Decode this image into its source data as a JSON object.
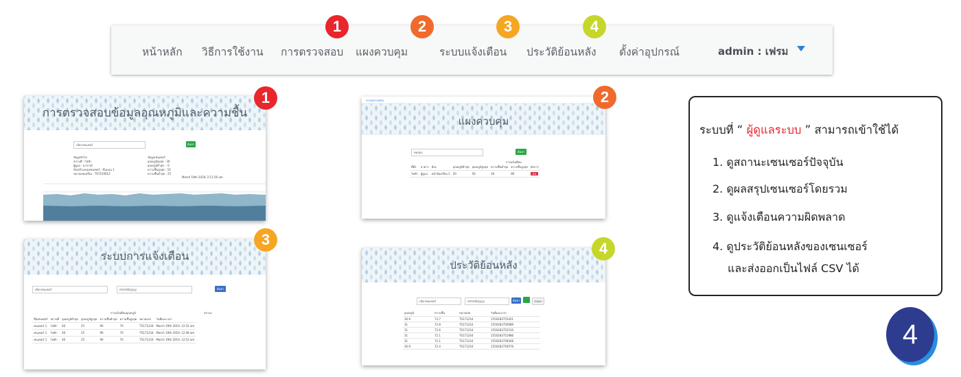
{
  "nav": {
    "items": [
      "หน้าหลัก",
      "วิธีการใช้งาน",
      "การตรวจสอบ",
      "แผงควบคุม",
      "ระบบแจ้งเตือน",
      "ประวัติย้อนหลัง",
      "ตั้งค่าอุปกรณ์"
    ],
    "user": "admin : เฟรม"
  },
  "badges": {
    "b1": "1",
    "b2": "2",
    "b3": "3",
    "b4": "4",
    "colors": {
      "b1": "#e8262c",
      "b2": "#ef6a2c",
      "b3": "#f5a623",
      "b4": "#c6d62b"
    }
  },
  "shot1": {
    "title": "การตรวจสอบข้อมูลอุณหภูมิและความชื้น",
    "select": "เลือกเซนเซอร์",
    "button": "ค้นหา",
    "info_left": [
      "ข้อมูลทั่วไป",
      "สถานที่ : ไฟฟ้า",
      "ผู้ดูแล : อาจารย์",
      "ห้อง/ตำแหน่งเซนเซอร์ : ชั้นบนน 1",
      "หมายเลขเครื่อง : TS7150012"
    ],
    "info_right": [
      "ข้อมูลเซนเซอร์",
      "อุณหภูมิสูงสุด : 30",
      "อุณหภูมิต่ำสุด : -5",
      "ความชื้นสูงสุด : 10",
      "ความชื้นต่ำสุด : 25"
    ],
    "timestamp": "March 19th 2019, 2:11:56 am"
  },
  "shot2": {
    "brand": "ระบบตรวจสอบ",
    "title": "แผงควบคุม",
    "select": "ทดสอบ",
    "button": "ค้นหา",
    "group_header": "การแจ้งเตือน",
    "headers": [
      "ที่ตั้ง",
      "อาคาร",
      "ห้อง",
      "อุณหภูมิต่ำสุด",
      "อุณหภูมิสูงสุด",
      "ความชื้นต่ำสุด",
      "ความชื้นสูงสุด",
      "จัดการ"
    ],
    "row": [
      "ไฟฟ้า",
      "ผู้ดูแล",
      "หน้าห้องเรียน 2",
      "20",
      "50",
      "30",
      "80"
    ],
    "action": "ลบ"
  },
  "shot3": {
    "title": "ระบบการแจ้งเตือน",
    "select": "เลือกเซนเซอร์",
    "date": "mm/dd/yyyy",
    "button": "ค้นหา",
    "group_temp": "การแจ้งเตือนอุณหภูมิ",
    "group_status": "สถานะ",
    "headers": [
      "ชื่อเซนเซอร์",
      "สถานที่",
      "อุณหภูมิต่ำสุด",
      "อุณหภูมิสูงสุด",
      "ความชื้นต่ำสุด",
      "ความชื้นสูงสุด",
      "อุณหภูมิ",
      "ความชื้น",
      "ข้อความแจ้งเตือน",
      "หมายเลข",
      "วันที่และเวลา"
    ],
    "rows": [
      [
        "เซนเซอร์ 1",
        "ไฟฟ้า",
        "40",
        "25",
        "90",
        "70",
        "TS171234",
        "March 19th 2019, 12:22 am"
      ],
      [
        "เซนเซอร์ 1",
        "ไฟฟ้า",
        "40",
        "25",
        "90",
        "70",
        "TS171234",
        "March 19th 2019, 12:48 am"
      ],
      [
        "เซนเซอร์ 1",
        "ไฟฟ้า",
        "40",
        "25",
        "90",
        "70",
        "TS171234",
        "March 19th 2019, 12:53 am"
      ]
    ]
  },
  "shot4": {
    "title": "ประวัติย้อนหลัง",
    "select": "เลือกเซนเซอร์",
    "date": "mm/dd/yyyy",
    "button": "ค้นหา",
    "export": "ส่งออก",
    "headers": [
      "อุณหภูมิ",
      "ความชื้น",
      "หมายเลข",
      "วันที่และเวลา"
    ],
    "rows": [
      [
        "30.9",
        "73.7",
        "TS171234",
        "1550283753421"
      ],
      [
        "31",
        "72.8",
        "TS171234",
        "1550283750989"
      ],
      [
        "31",
        "72.6",
        "TS171234",
        "1550283752510"
      ],
      [
        "31",
        "72.1",
        "TS171234",
        "1550283751986"
      ],
      [
        "31",
        "72.1",
        "TS171234",
        "1550283758566"
      ],
      [
        "30.9",
        "72.4",
        "TS171234",
        "1550283759576"
      ]
    ]
  },
  "infobox": {
    "prefix": "ระบบที่ “",
    "role": "ผู้ดูแลระบบ",
    "suffix": "” สามารถเข้าใช้ได้",
    "items": [
      "1. ดูสถานะเซนเซอร์ปัจจุบัน",
      "2. ดูผลสรุปเซนเซอร์โดยรวม",
      "3. ดูแจ้งเตือนความผิดพลาด",
      "4. ดูประวัติย้อนหลังของเซนเซอร์",
      "และส่งออกเป็นไฟล์ CSV ได้"
    ]
  },
  "big_badge": "4",
  "colors": {
    "accent_red": "#e8262c",
    "dark_blue": "#2d3c8f",
    "light_blue": "#2b8de0",
    "caret": "#2d7fd3"
  }
}
